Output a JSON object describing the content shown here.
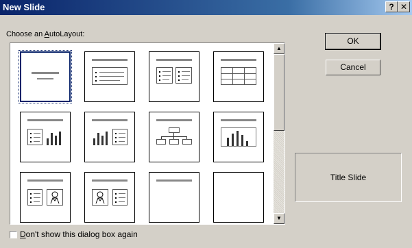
{
  "window": {
    "title": "New Slide",
    "help_glyph": "?",
    "close_glyph": "✕"
  },
  "prompt": {
    "before": "Choose an ",
    "accel": "A",
    "after": "utoLayout:"
  },
  "buttons": {
    "ok": "OK",
    "cancel": "Cancel"
  },
  "preview": {
    "label": "Title Slide"
  },
  "checkbox": {
    "accel": "D",
    "label": "on't show this dialog box again",
    "checked": false
  },
  "scrollbar": {
    "up_arrow": "▲",
    "down_arrow": "▼"
  },
  "layouts": [
    {
      "name": "Title Slide",
      "selected": true
    },
    {
      "name": "Bulleted List"
    },
    {
      "name": "Two Column Text"
    },
    {
      "name": "Table"
    },
    {
      "name": "Text & Chart"
    },
    {
      "name": "Chart & Text"
    },
    {
      "name": "Organization Chart"
    },
    {
      "name": "Chart"
    },
    {
      "name": "Text & Clip Art"
    },
    {
      "name": "Clip Art & Text"
    },
    {
      "name": "Title Only"
    },
    {
      "name": "Blank"
    }
  ],
  "colors": {
    "title_bar": "#0a246a",
    "dialog_bg": "#d4d0c8",
    "selection": "#0a246a"
  }
}
